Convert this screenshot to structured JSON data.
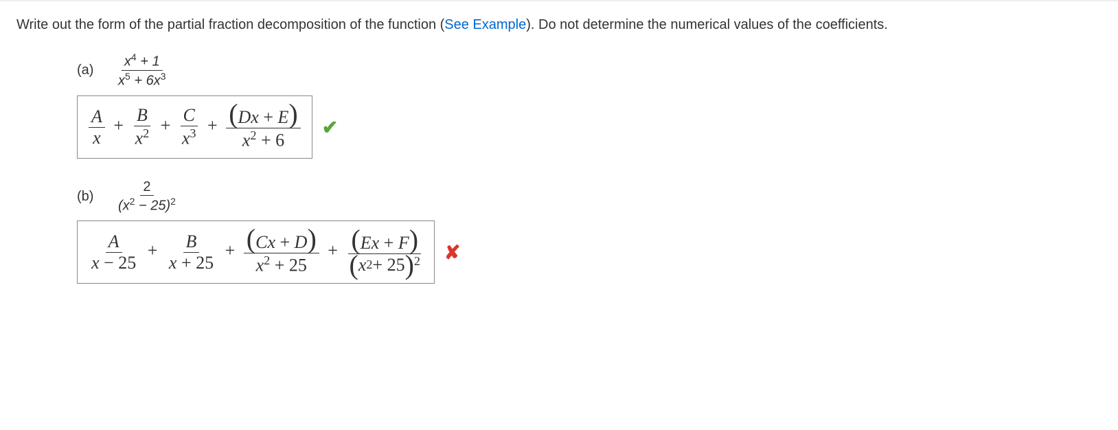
{
  "instruction": {
    "pre": "Write out the form of the partial fraction decomposition of the function (",
    "link": "See Example",
    "post": "). Do not determine the numerical values of the coefficients."
  },
  "parts": {
    "a": {
      "label": "(a)",
      "q_num": "x⁴ + 1",
      "q_den": "x⁵ + 6x³",
      "t1_num": "A",
      "t1_den": "x",
      "t2_num": "B",
      "t2_den": "x²",
      "t3_num": "C",
      "t3_den": "x³",
      "t4_num": "Dx + E",
      "t4_den": "x² + 6",
      "status": "correct"
    },
    "b": {
      "label": "(b)",
      "q_num": "2",
      "q_den": "(x² − 25)²",
      "t1_num": "A",
      "t1_den": "x − 25",
      "t2_num": "B",
      "t2_den": "x + 25",
      "t3_num": "Cx + D",
      "t3_den": "x² + 25",
      "t4_num": "Ex + F",
      "t4_den": "(x² + 25)²",
      "status": "incorrect"
    }
  },
  "plus": "+",
  "chart_data": null
}
